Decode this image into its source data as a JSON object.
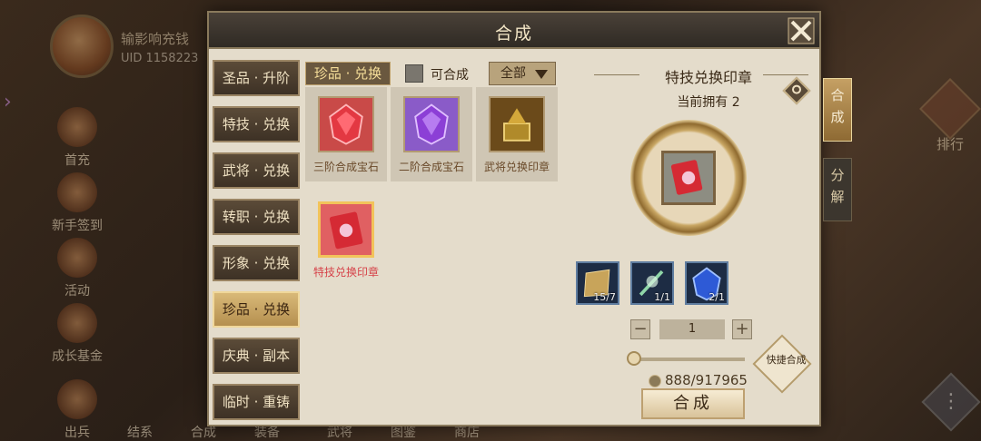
{
  "background": {
    "player_name": "输影响充钱",
    "uid": "UID 1158223",
    "side_menu": [
      {
        "label": "首充",
        "icon": "gift-icon"
      },
      {
        "label": "新手签到",
        "icon": "signin-icon"
      },
      {
        "label": "活动",
        "icon": "event-icon"
      },
      {
        "label": "成长基金",
        "icon": "fund-icon"
      },
      {
        "label": "出兵",
        "icon": "army-icon"
      }
    ],
    "right_item": {
      "label": "排行",
      "icon": "ranking-icon"
    },
    "bottom_labels": [
      "结系",
      "合成",
      "装备",
      "武将",
      "图鉴",
      "商店"
    ]
  },
  "dialog": {
    "title": "合成",
    "close_icon": "close-icon",
    "categories": [
      {
        "label": "圣品 · 升阶",
        "active": false
      },
      {
        "label": "特技 · 兑换",
        "active": false
      },
      {
        "label": "武将 · 兑换",
        "active": false
      },
      {
        "label": "转职 · 兑换",
        "active": false
      },
      {
        "label": "形象 · 兑换",
        "active": false
      },
      {
        "label": "珍品 · 兑换",
        "active": true
      },
      {
        "label": "庆典 · 副本",
        "active": false
      },
      {
        "label": "临时 · 重铸",
        "active": false
      }
    ],
    "current_tab": "珍品 · 兑换",
    "checkbox_label": "可合成",
    "filter_value": "全部",
    "items": [
      {
        "name": "三阶合成宝石",
        "icon": "red-gem-icon",
        "color": "#d8353c",
        "bg": "#c94a48",
        "selected": false
      },
      {
        "name": "二阶合成宝石",
        "icon": "purple-gem-icon",
        "color": "#8c3fd6",
        "bg": "#8a5bc8",
        "selected": false
      },
      {
        "name": "武将兑换印章",
        "icon": "general-seal-icon",
        "color": "#b08a2a",
        "bg": "#6b4a1a",
        "selected": false
      },
      {
        "name": "特技兑换印章",
        "icon": "skill-seal-icon",
        "color": "#d6434a",
        "bg": "#e06062",
        "selected": true
      }
    ],
    "detail": {
      "title": "特技兑换印章",
      "owned": "当前拥有 2",
      "item_icon": "skill-seal-icon",
      "materials": [
        {
          "icon": "scroll-icon",
          "count": "15/7",
          "color": "#c8a45a"
        },
        {
          "icon": "herb-icon",
          "count": "1/1",
          "color": "#8fd6a8"
        },
        {
          "icon": "blue-gem-icon",
          "count": "2/1",
          "color": "#2e5ad6"
        }
      ],
      "quantity": "1",
      "minus": "−",
      "plus": "+",
      "slider_fraction": 0.0,
      "quick_label": "快捷合成",
      "cost": "888/917965",
      "craft_label": "合成"
    },
    "side_tabs": [
      {
        "label": "合成",
        "active": true
      },
      {
        "label": "分解",
        "active": false
      }
    ]
  }
}
